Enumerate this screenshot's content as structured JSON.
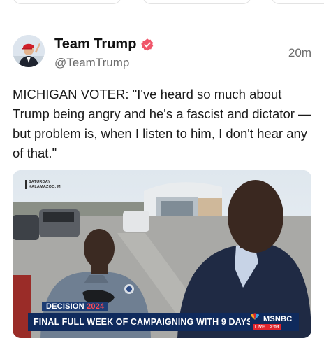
{
  "author": {
    "display_name": "Team Trump",
    "handle": "@TeamTrump",
    "verified_icon": "verified-badge-icon",
    "accent": "#f0566a"
  },
  "post": {
    "timestamp": "20m",
    "text": "MICHIGAN VOTER: \"I've heard so much about Trump being angry and he's a fascist and dictator — but problem is, when I listen to him, I don't hear any of that.\""
  },
  "video": {
    "location_bug_line1": "SATURDAY",
    "location_bug_line2": "KALAMAZOO, MI",
    "decision_label": "DECISION",
    "decision_year": "2024",
    "headline": "FINAL FULL WEEK OF CAMPAIGNING WITH 9 DAYS LEFT",
    "network": "MSNBC",
    "live_label": "LIVE",
    "clock": "2:03"
  },
  "colors": {
    "chyron_bg": "#0f2a5c",
    "decision_bg": "#1e3d74",
    "live_red": "#e0242c"
  }
}
